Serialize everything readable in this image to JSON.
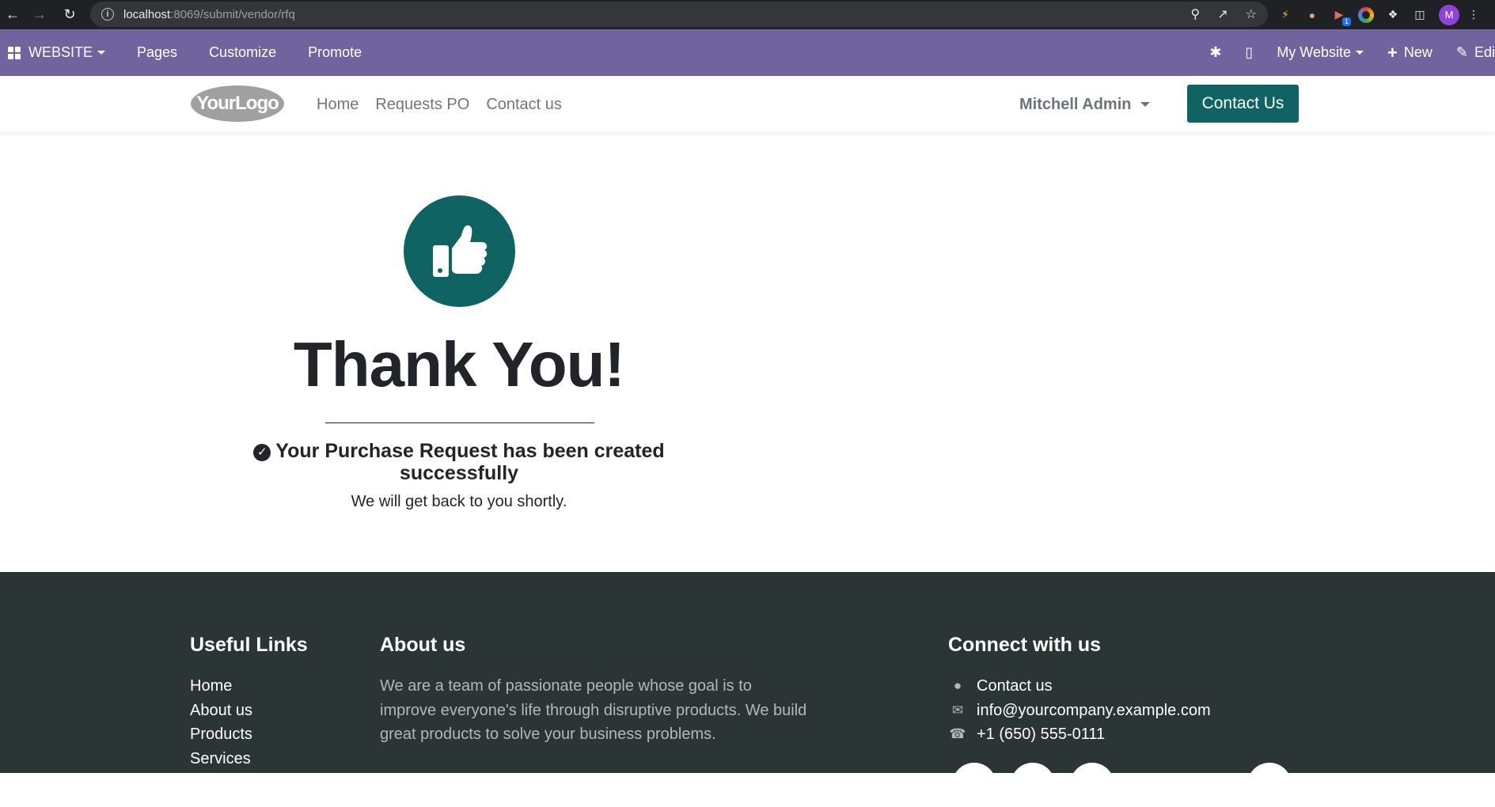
{
  "browser": {
    "url_host": "localhost",
    "url_path": ":8069/submit/vendor/rfq",
    "extension_badge": "1",
    "profile_initial": "M"
  },
  "editbar": {
    "apps_label": "WEBSITE",
    "menu": [
      "Pages",
      "Customize",
      "Promote"
    ],
    "my_website": "My Website",
    "new_label": "New",
    "edit_label": "Edi"
  },
  "header": {
    "logo_text": "YourLogo",
    "nav": [
      "Home",
      "Requests PO",
      "Contact us"
    ],
    "user": "Mitchell Admin",
    "cta": "Contact Us"
  },
  "main": {
    "title": "Thank You!",
    "success_line1": "Your Purchase Request has been created",
    "success_line2": "successfully",
    "followup": "We will get back to you shortly."
  },
  "footer": {
    "useful_links_title": "Useful Links",
    "useful_links": [
      "Home",
      "About us",
      "Products",
      "Services"
    ],
    "about_title": "About us",
    "about_text": "We are a team of passionate people whose goal is to improve everyone's life through disruptive products. We build great products to solve your business problems.",
    "connect_title": "Connect with us",
    "contact_link": "Contact us",
    "email": "info@yourcompany.example.com",
    "phone": "+1 (650) 555-0111"
  },
  "colors": {
    "editbar": "#71639e",
    "brand": "#0f6463",
    "footer_bg": "#2b3536"
  }
}
